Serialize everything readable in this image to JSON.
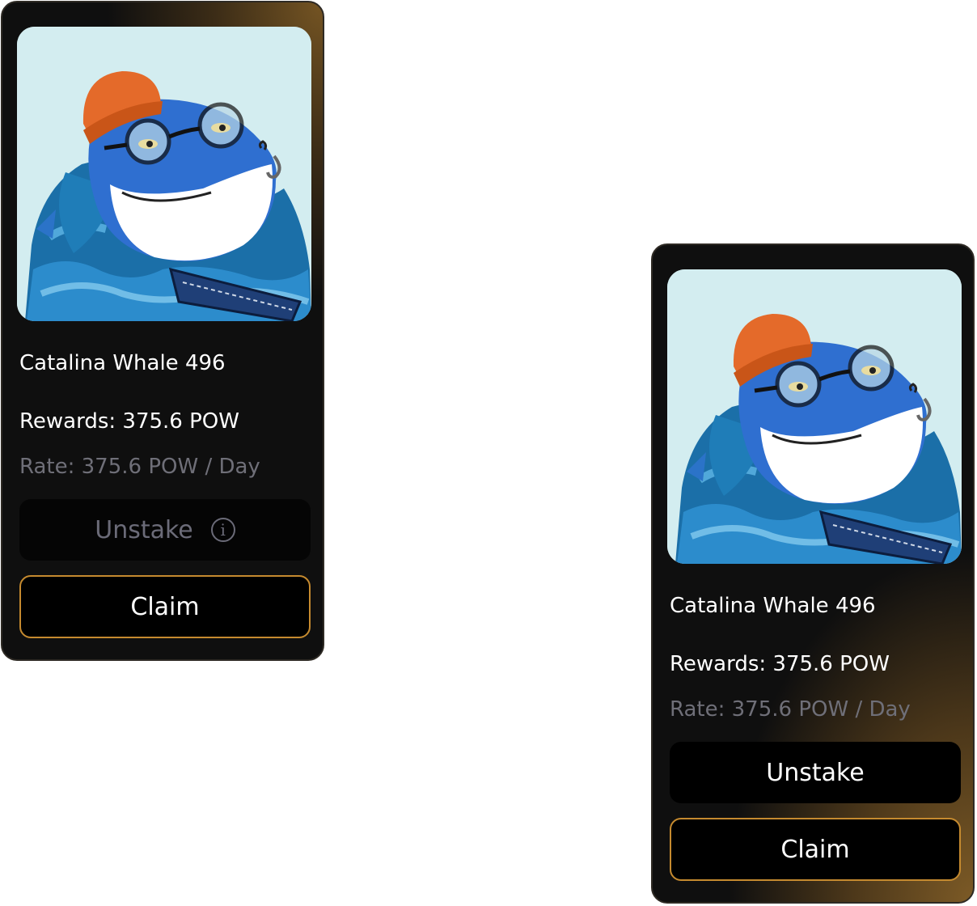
{
  "cards": [
    {
      "name": "Catalina Whale 496",
      "rewards": "Rewards:  375.6 POW",
      "rate": "Rate: 375.6 POW / Day",
      "unstake_label": "Unstake",
      "unstake_state": "disabled",
      "claim_label": "Claim"
    },
    {
      "name": "Catalina Whale 496",
      "rewards": "Rewards:  375.6 POW",
      "rate": "Rate: 375.6 POW / Day",
      "unstake_label": "Unstake",
      "unstake_state": "enabled",
      "claim_label": "Claim"
    }
  ],
  "colors": {
    "accent_border": "#c58a2f",
    "gradient_gold": "#7a5824",
    "image_bg": "#d3edf0",
    "muted_text": "#6f6f78"
  }
}
